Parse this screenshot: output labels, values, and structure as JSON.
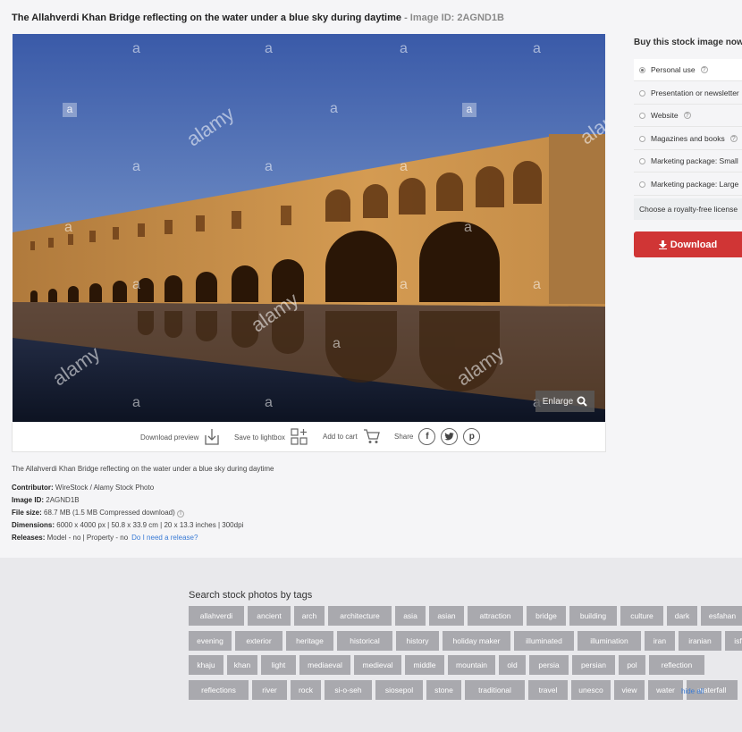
{
  "header": {
    "title": "The Allahverdi Khan Bridge reflecting on the water under a blue sky during daytime",
    "image_id_label": " - Image ID: 2AGND1B"
  },
  "photo": {
    "watermark_letter": "a",
    "watermark_word": "alamy",
    "enlarge_label": "Enlarge"
  },
  "actions": {
    "download_preview": "Download preview",
    "save_lightbox": "Save to lightbox",
    "add_cart": "Add to cart",
    "share": "Share",
    "share_icons": [
      "facebook-icon",
      "twitter-icon",
      "pinterest-icon"
    ]
  },
  "details": {
    "caption": "The Allahverdi Khan Bridge reflecting on the water under a blue sky during daytime",
    "contributor_label": "Contributor:",
    "contributor": "WireStock / Alamy Stock Photo",
    "image_id_label": "Image ID:",
    "image_id": "2AGND1B",
    "file_size_label": "File size:",
    "file_size": "68.7 MB (1.5 MB Compressed download)",
    "dimensions_label": "Dimensions:",
    "dimensions": "6000 x 4000 px | 50.8 x 33.9 cm | 20 x 13.3 inches | 300dpi",
    "releases_label": "Releases:",
    "releases": "Model - no | Property - no",
    "release_link": "Do I need a release?"
  },
  "buy": {
    "title": "Buy this stock image now",
    "options": [
      {
        "label": "Personal use",
        "help": true,
        "selected": true
      },
      {
        "label": "Presentation or newsletter",
        "help": false,
        "selected": false
      },
      {
        "label": "Website",
        "help": true,
        "selected": false
      },
      {
        "label": "Magazines and books",
        "help": true,
        "selected": false
      },
      {
        "label": "Marketing package: Small",
        "help": false,
        "selected": false
      },
      {
        "label": "Marketing package: Large",
        "help": false,
        "selected": false
      }
    ],
    "royalty_free": "Choose a royalty-free license",
    "download": "Download"
  },
  "tags": {
    "title": "Search stock photos by tags",
    "rows": [
      [
        "allahverdi",
        "ancient",
        "arch",
        "architecture",
        "asia",
        "asian",
        "attraction",
        "bridge",
        "building",
        "culture",
        "dark",
        "esfahan"
      ],
      [
        "evening",
        "exterior",
        "heritage",
        "historical",
        "history",
        "holiday maker",
        "illuminated",
        "illumination",
        "iran",
        "iranian",
        "isfahan"
      ],
      [
        "khaju",
        "khan",
        "light",
        "mediaeval",
        "medieval",
        "middle",
        "mountain",
        "old",
        "persia",
        "persian",
        "pol",
        "reflection"
      ],
      [
        "reflections",
        "river",
        "rock",
        "si-o-seh",
        "siosepol",
        "stone",
        "traditional",
        "travel",
        "unesco",
        "view",
        "water",
        "waterfall"
      ]
    ],
    "hide_all": "hide all"
  }
}
